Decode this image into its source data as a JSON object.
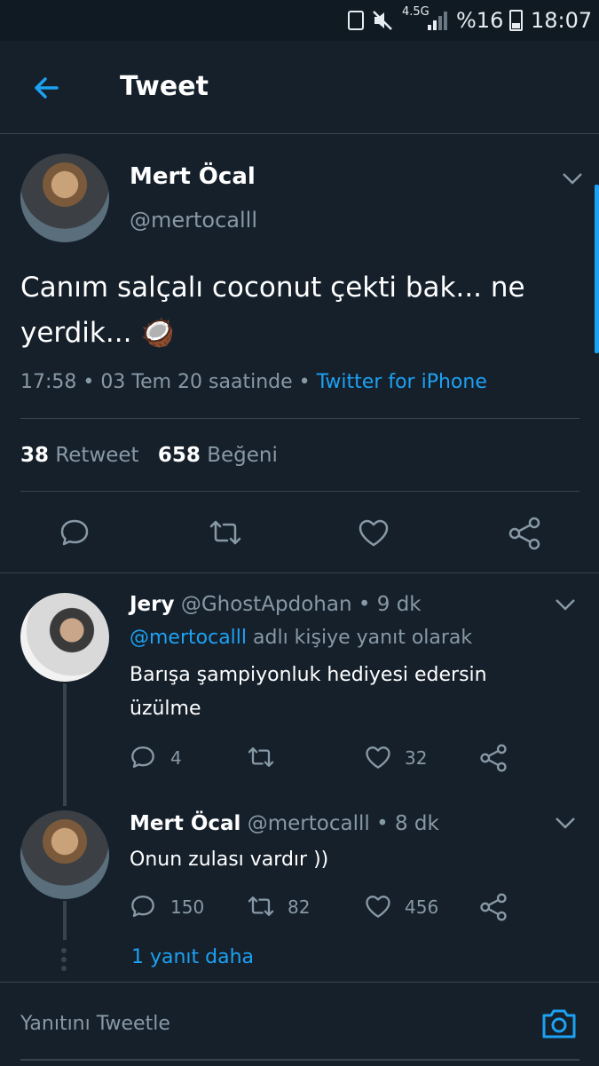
{
  "status_bar": {
    "network": "4.5G",
    "battery": "%16",
    "time": "18:07"
  },
  "header": {
    "title": "Tweet"
  },
  "tweet": {
    "author_name": "Mert Öcal",
    "author_handle": "@mertocalll",
    "text_line1": "Canım salçalı coconut çekti bak... ne",
    "text_line2": "yerdik... 🥥",
    "time": "17:58",
    "date": "03 Tem 20 saatinde",
    "source": "Twitter for iPhone",
    "retweet_count": "38",
    "retweet_label": "Retweet",
    "like_count": "658",
    "like_label": "Beğeni"
  },
  "replies": [
    {
      "author_name": "Jery",
      "author_handle": "@GhostApdohan",
      "age": "9 dk",
      "reply_to_handle": "@mertocalll",
      "reply_to_suffix": "adlı kişiye yanıt olarak",
      "text_line1": "Barışa şampiyonluk hediyesi edersin",
      "text_line2": "üzülme",
      "reply_count": "4",
      "retweet_count": "",
      "like_count": "32"
    },
    {
      "author_name": "Mert Öcal",
      "author_handle": "@mertocalll",
      "age": "8 dk",
      "text_line1": "Onun zulası vardır ))",
      "reply_count": "150",
      "retweet_count": "82",
      "like_count": "456"
    }
  ],
  "more_replies": "1 yanıt daha",
  "compose": {
    "placeholder": "Yanıtını Tweetle"
  },
  "colors": {
    "background": "#15202b",
    "accent": "#1da1f2",
    "muted": "#8899a6",
    "divider": "#38444d"
  },
  "icons": [
    "back-arrow-icon",
    "chevron-down-icon",
    "reply-icon",
    "retweet-icon",
    "like-icon",
    "share-icon",
    "camera-icon"
  ]
}
